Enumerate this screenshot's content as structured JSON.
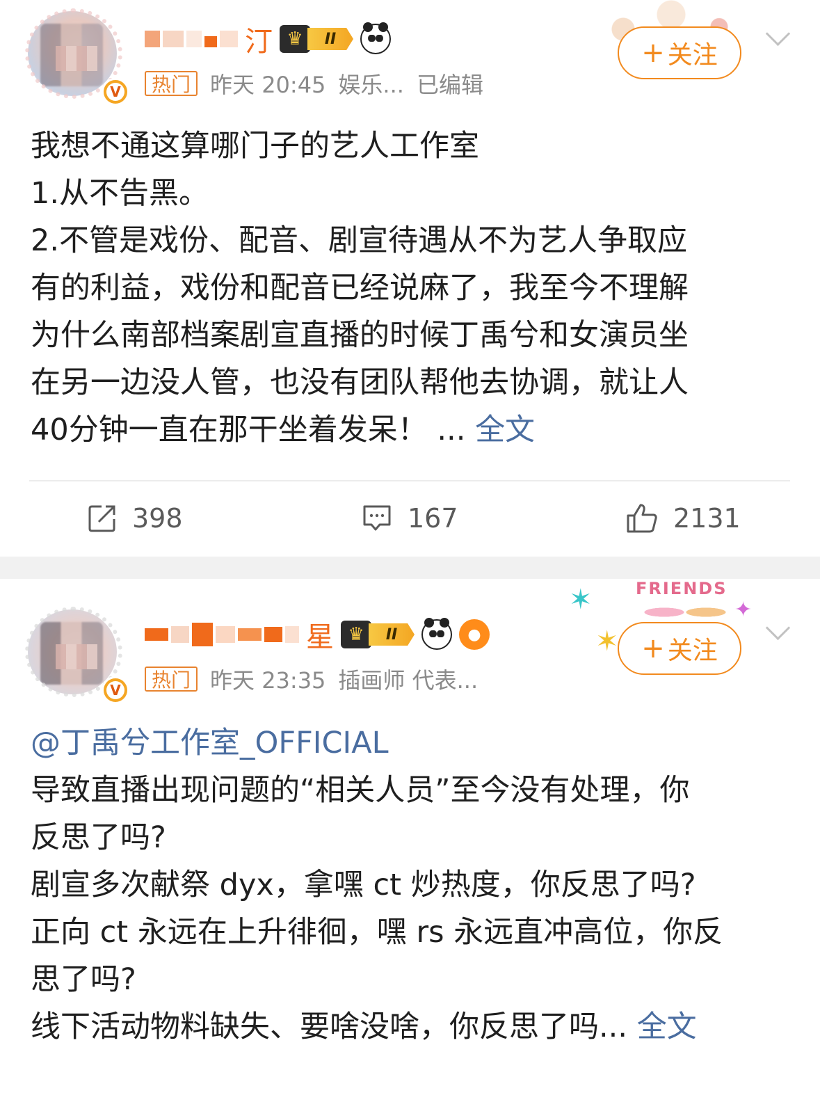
{
  "posts": [
    {
      "user": {
        "name_visible_tail": "汀",
        "vip_level": "II"
      },
      "hot_tag": "热门",
      "time": "昨天 20:45",
      "category": "娱乐...",
      "edited": "已编辑",
      "follow_label": "关注",
      "content_lines": [
        "我想不通这算哪门子的艺人工作室",
        "1.从不告黑。",
        "2.不管是戏份、配音、剧宣待遇从不为艺人争取应",
        "有的利益，戏份和配音已经说麻了，我至今不理解",
        "为什么南部档案剧宣直播的时候丁禹兮和女演员坐",
        "在另一边没人管，也没有团队帮他去协调，就让人",
        "40分钟一直在那干坐着发呆！ ..."
      ],
      "more_label": "全文",
      "actions": {
        "repost": "398",
        "comment": "167",
        "like": "2131"
      }
    },
    {
      "user": {
        "name_visible_tail": "星",
        "vip_level": "II"
      },
      "hot_tag": "热门",
      "time": "昨天 23:35",
      "category": "插画师 代表...",
      "follow_label": "关注",
      "friends_sticker": "FRIENDS",
      "mention": "@丁禹兮工作室_OFFICIAL",
      "content_lines": [
        "导致直播出现问题的“相关人员”至今没有处理，你",
        "反思了吗?",
        "剧宣多次献祭 dyx，拿嘿 ct 炒热度，你反思了吗?",
        "正向 ct 永远在上升徘徊，嘿 rs 永远直冲高位，你反",
        "思了吗?",
        "线下活动物料缺失、要啥没啥，你反思了吗..."
      ],
      "more_label": "全文"
    }
  ],
  "colors": {
    "accent_orange": "#f28a1e",
    "link_blue": "#4a6da0",
    "meta_gray": "#8a8a8a"
  }
}
